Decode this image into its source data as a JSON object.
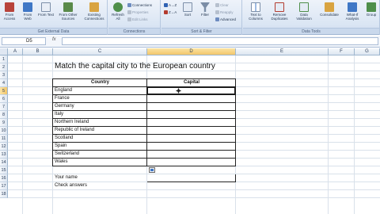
{
  "ribbon": {
    "groups": [
      {
        "label": "Get External Data"
      },
      {
        "label": "Connections"
      },
      {
        "label": "Sort & Filter"
      },
      {
        "label": "Data Tools"
      }
    ],
    "buttons": {
      "from_access": "From Access",
      "from_web": "From Web",
      "from_text": "From Text",
      "from_other": "From Other Sources",
      "existing": "Existing Connections",
      "refresh": "Refresh All",
      "connections": "Connections",
      "properties": "Properties",
      "edit_links": "Edit Links",
      "sort_az": "A→Z",
      "sort_za": "Z→A",
      "sort": "Sort",
      "filter": "Filter",
      "clear": "Clear",
      "reapply": "Reapply",
      "advanced": "Advanced",
      "text_to_columns": "Text to Columns",
      "remove_duplicates": "Remove Duplicates",
      "data_validation": "Data Validation",
      "consolidate": "Consolidate",
      "what_if": "What-If Analysis",
      "group": "Group"
    }
  },
  "formula_bar": {
    "name_box": "D5",
    "fx": "fx",
    "value": ""
  },
  "grid": {
    "columns": [
      "A",
      "B",
      "C",
      "D",
      "E",
      "F",
      "G"
    ],
    "active_column": "D",
    "rows": [
      "1",
      "2",
      "3",
      "4",
      "5",
      "6",
      "7",
      "8",
      "9",
      "10",
      "11",
      "12",
      "13",
      "14",
      "15",
      "16",
      "17",
      "18"
    ],
    "active_row": "5"
  },
  "sheet": {
    "title": "Match the capital city to the European country",
    "header_country": "Country",
    "header_capital": "Capital",
    "countries": [
      "England",
      "France",
      "Germany",
      "Italy",
      "Northern Ireland",
      "Republic of Ireland",
      "Scotland",
      "Spain",
      "Switzerland",
      "Wales"
    ],
    "your_name_label": "Your name",
    "check_answers_label": "Check answers"
  }
}
